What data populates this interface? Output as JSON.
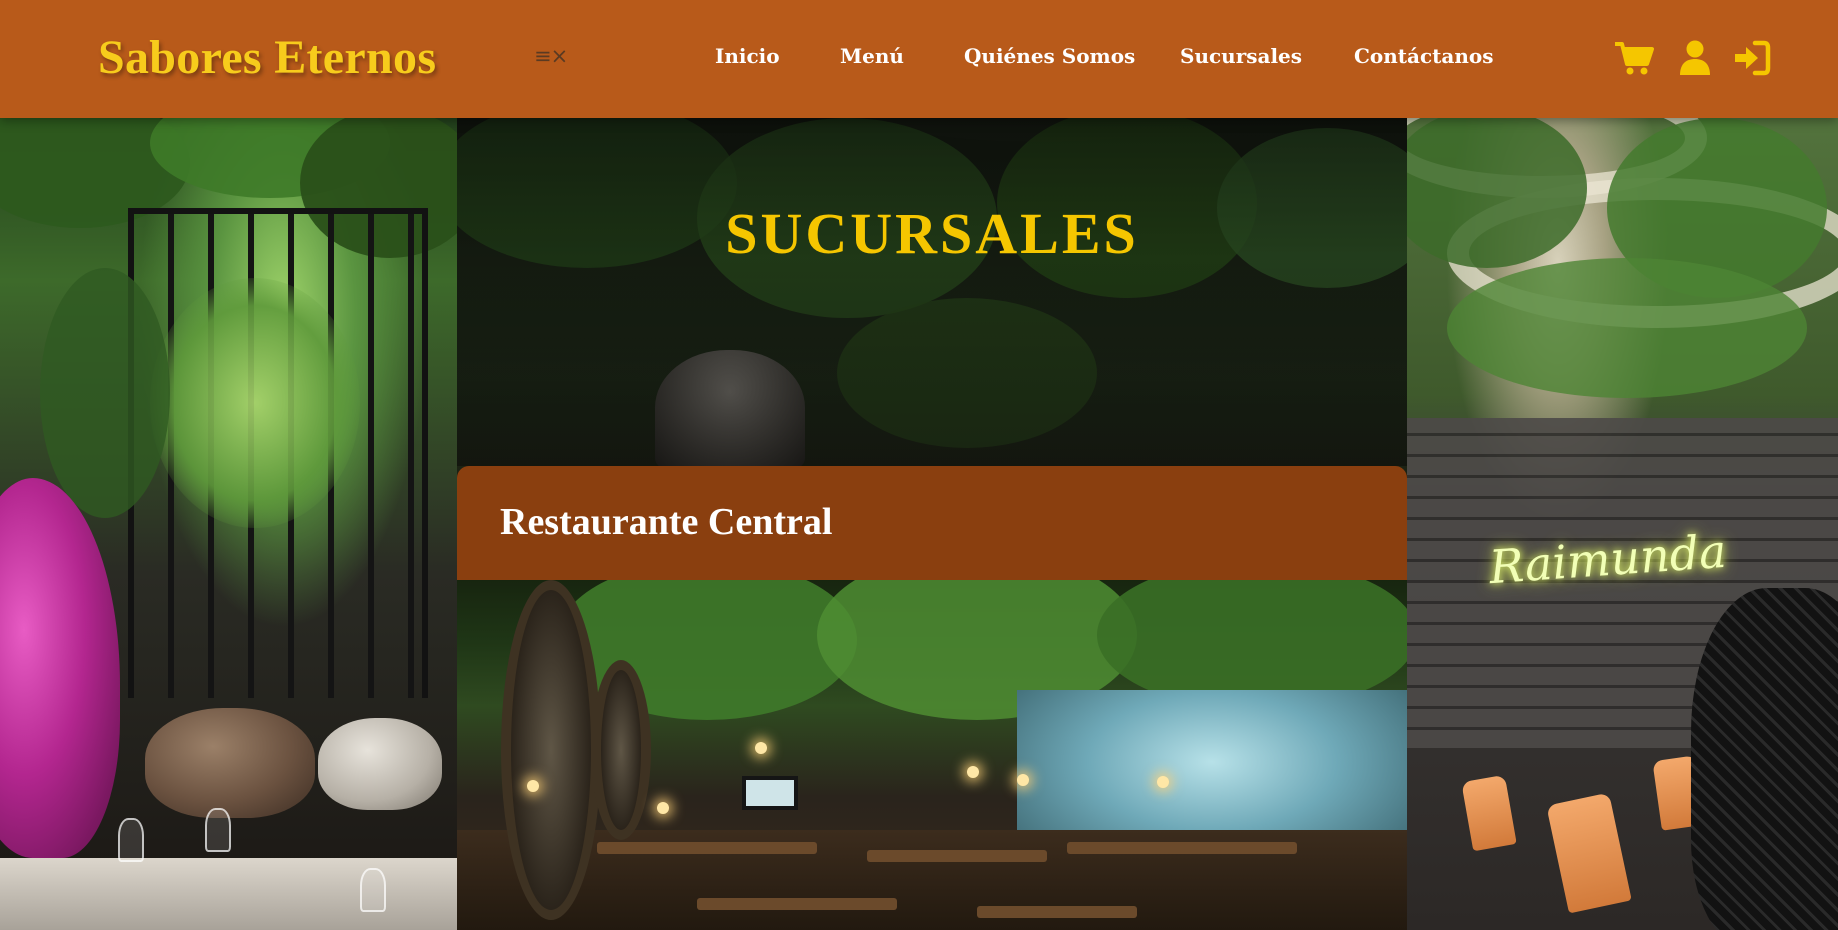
{
  "header": {
    "brand": "Sabores Eternos",
    "menu_toggle": "≡×",
    "nav": {
      "inicio": "Inicio",
      "menu": "Menú",
      "quienes": "Quiénes Somos",
      "sucursales": "Sucursales",
      "contact": "Contáctanos"
    },
    "icons": [
      "cart-icon",
      "user-icon",
      "login-icon"
    ]
  },
  "hero": {
    "heading": "SUCURSALES",
    "neon_sign": "Raimunda"
  },
  "branch": {
    "name": "Restaurante Central"
  },
  "colors": {
    "header_bg": "#b85a1a",
    "brand": "#f7cc1c",
    "heading": "#f5c600",
    "card_header": "#8a3f0f",
    "icons": "#f5c600"
  }
}
